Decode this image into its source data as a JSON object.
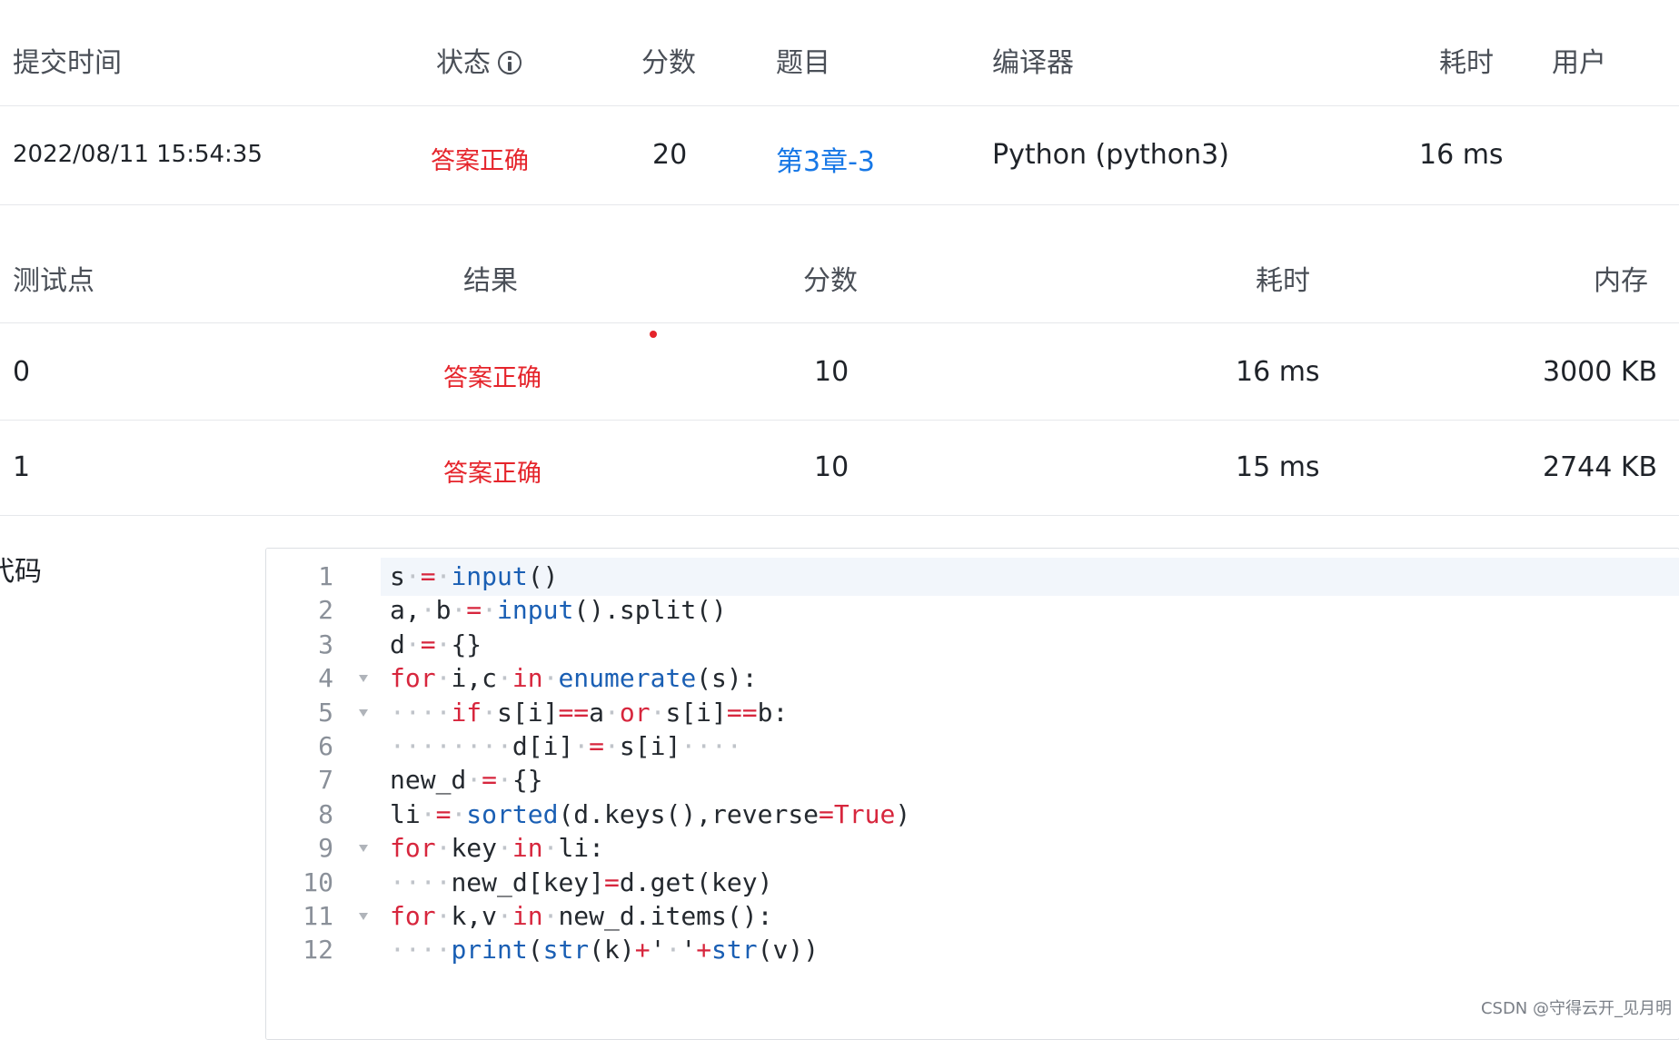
{
  "submission_table": {
    "headers": {
      "time": "提交时间",
      "status": "状态",
      "score": "分数",
      "problem": "题目",
      "compiler": "编译器",
      "elapsed": "耗时",
      "user": "用户"
    },
    "row": {
      "time": "2022/08/11 15:54:35",
      "status": "答案正确",
      "score": "20",
      "problem": "第3章-3",
      "compiler": "Python (python3)",
      "elapsed": "16 ms",
      "user": ""
    }
  },
  "testcase_table": {
    "headers": {
      "point": "测试点",
      "result": "结果",
      "score": "分数",
      "elapsed": "耗时",
      "memory": "内存"
    },
    "rows": [
      {
        "point": "0",
        "result": "答案正确",
        "score": "10",
        "elapsed": "16 ms",
        "memory": "3000 KB"
      },
      {
        "point": "1",
        "result": "答案正确",
        "score": "10",
        "elapsed": "15 ms",
        "memory": "2744 KB"
      }
    ]
  },
  "code_section": {
    "label": "代码",
    "lines": [
      {
        "num": "1",
        "foldable": false,
        "text": "s = input()"
      },
      {
        "num": "2",
        "foldable": false,
        "text": "a, b = input().split()"
      },
      {
        "num": "3",
        "foldable": false,
        "text": "d = {}"
      },
      {
        "num": "4",
        "foldable": true,
        "text": "for i,c in enumerate(s):"
      },
      {
        "num": "5",
        "foldable": true,
        "text": "    if s[i]==a or s[i]==b:"
      },
      {
        "num": "6",
        "foldable": false,
        "text": "        d[i] = s[i]    "
      },
      {
        "num": "7",
        "foldable": false,
        "text": "new_d = {}"
      },
      {
        "num": "8",
        "foldable": false,
        "text": "li = sorted(d.keys(),reverse=True)"
      },
      {
        "num": "9",
        "foldable": true,
        "text": "for key in li:"
      },
      {
        "num": "10",
        "foldable": false,
        "text": "    new_d[key]=d.get(key)"
      },
      {
        "num": "11",
        "foldable": true,
        "text": "for k,v in new_d.items():"
      },
      {
        "num": "12",
        "foldable": false,
        "text": "    print(str(k)+' '+str(v))"
      }
    ]
  },
  "watermark": "CSDN @守得云开_见月明",
  "colors": {
    "accepted": "#e5242b",
    "link": "#1677e6",
    "keyword": "#d7263d",
    "builtin": "#1a5fb4"
  }
}
